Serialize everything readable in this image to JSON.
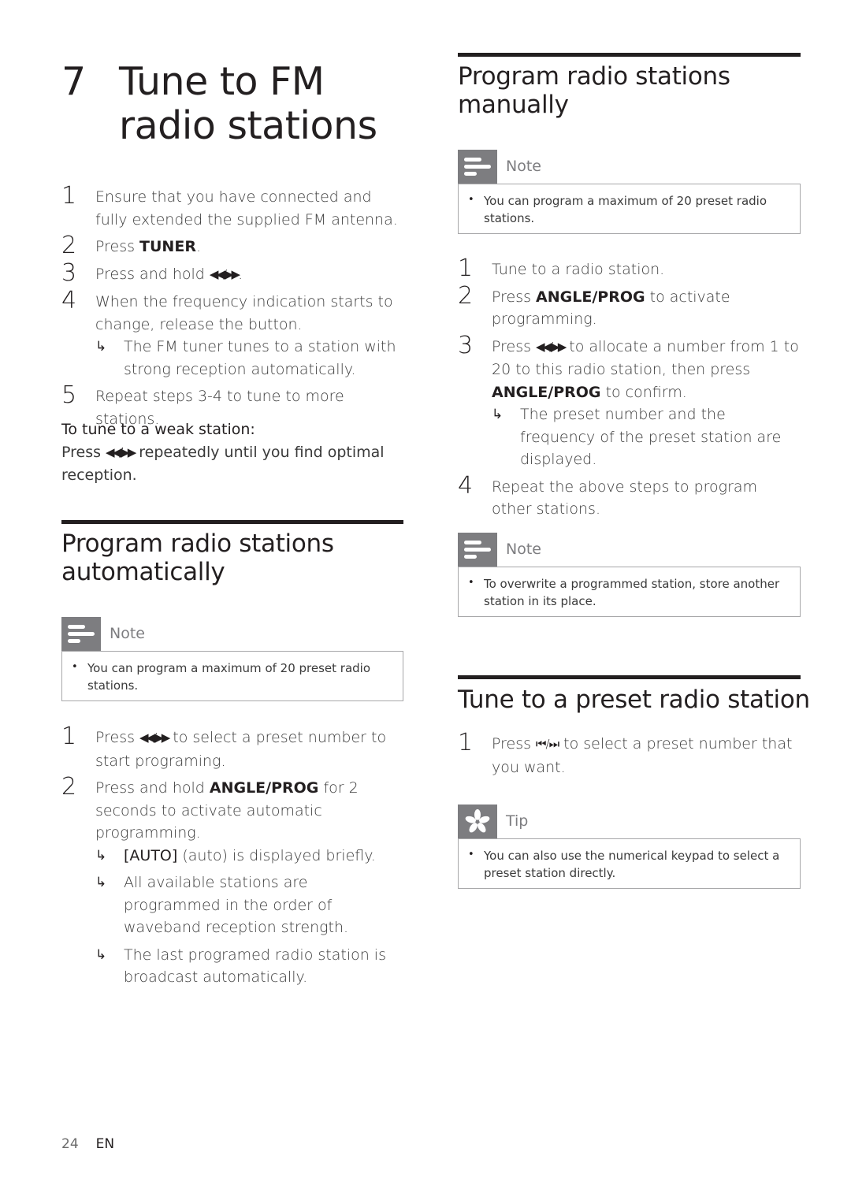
{
  "chapter": {
    "number": "7",
    "title": "Tune to FM radio stations"
  },
  "tune_steps": [
    {
      "num": "1",
      "text": "Ensure that you have connected and fully extended the supplied FM antenna."
    },
    {
      "num": "2",
      "pre": "Press ",
      "bold": "TUNER",
      "post": "."
    },
    {
      "num": "3",
      "pre": "Press and hold ",
      "glyph": "◀◀/▶▶",
      "post": "."
    },
    {
      "num": "4",
      "text": "When the frequency indication starts to change, release the button.",
      "result": "The FM tuner tunes to a station with strong reception automatically."
    },
    {
      "num": "5",
      "text": "Repeat steps 3-4 to tune to more stations."
    }
  ],
  "weak_station": {
    "heading": "To tune to a weak station:",
    "pre": "Press ",
    "glyph": "◀◀/▶▶",
    "post": " repeatedly until you find optimal reception."
  },
  "auto_section": {
    "title": "Program radio stations automatically",
    "note": {
      "label": "Note",
      "icon": "note-lines-icon",
      "text": "You can program a maximum of 20 preset radio stations."
    },
    "steps": [
      {
        "num": "1",
        "pre": "Press ",
        "glyph": "◀◀/▶▶",
        "post": " to select a preset number to start programing."
      },
      {
        "num": "2",
        "pre": "Press and hold ",
        "bold": "ANGLE/PROG",
        "post": " for 2 seconds to activate automatic programming.",
        "results": [
          {
            "bold": "[AUTO]",
            "text": " (auto) is displayed briefly."
          },
          {
            "text": "All available stations are programmed in the order of waveband reception strength."
          },
          {
            "text": "The last programed radio station is broadcast automatically."
          }
        ]
      }
    ]
  },
  "manual_section": {
    "title": "Program radio stations manually",
    "note": {
      "label": "Note",
      "icon": "note-lines-icon",
      "text": "You can program a maximum of 20 preset radio stations."
    },
    "steps": [
      {
        "num": "1",
        "text": "Tune to a radio station."
      },
      {
        "num": "2",
        "pre": "Press ",
        "bold": "ANGLE/PROG",
        "post": " to activate programming."
      },
      {
        "num": "3",
        "pre": "Press ",
        "glyph": "◀◀/▶▶",
        "mid": " to allocate a number from 1 to 20 to this radio station, then press ",
        "bold": "ANGLE/PROG",
        "post": " to confirm.",
        "result": "The preset number and the frequency of the preset station are displayed."
      },
      {
        "num": "4",
        "text": "Repeat the above steps to program other stations."
      }
    ],
    "note2": {
      "label": "Note",
      "icon": "note-lines-icon",
      "text": "To overwrite a programmed station, store another station in its place."
    }
  },
  "preset_section": {
    "title": "Tune to a preset radio station",
    "steps": [
      {
        "num": "1",
        "pre": "Press ",
        "glyph": "⏮/⏭",
        "post": " to select a preset number that you want."
      }
    ],
    "tip": {
      "label": "Tip",
      "icon": "tip-asterisk-icon",
      "text": "You can also use the numerical keypad to select a preset station directly."
    }
  },
  "footer": {
    "page": "24",
    "lang": "EN"
  },
  "symbols": {
    "result_arrow": "↳",
    "bullet": "•"
  }
}
